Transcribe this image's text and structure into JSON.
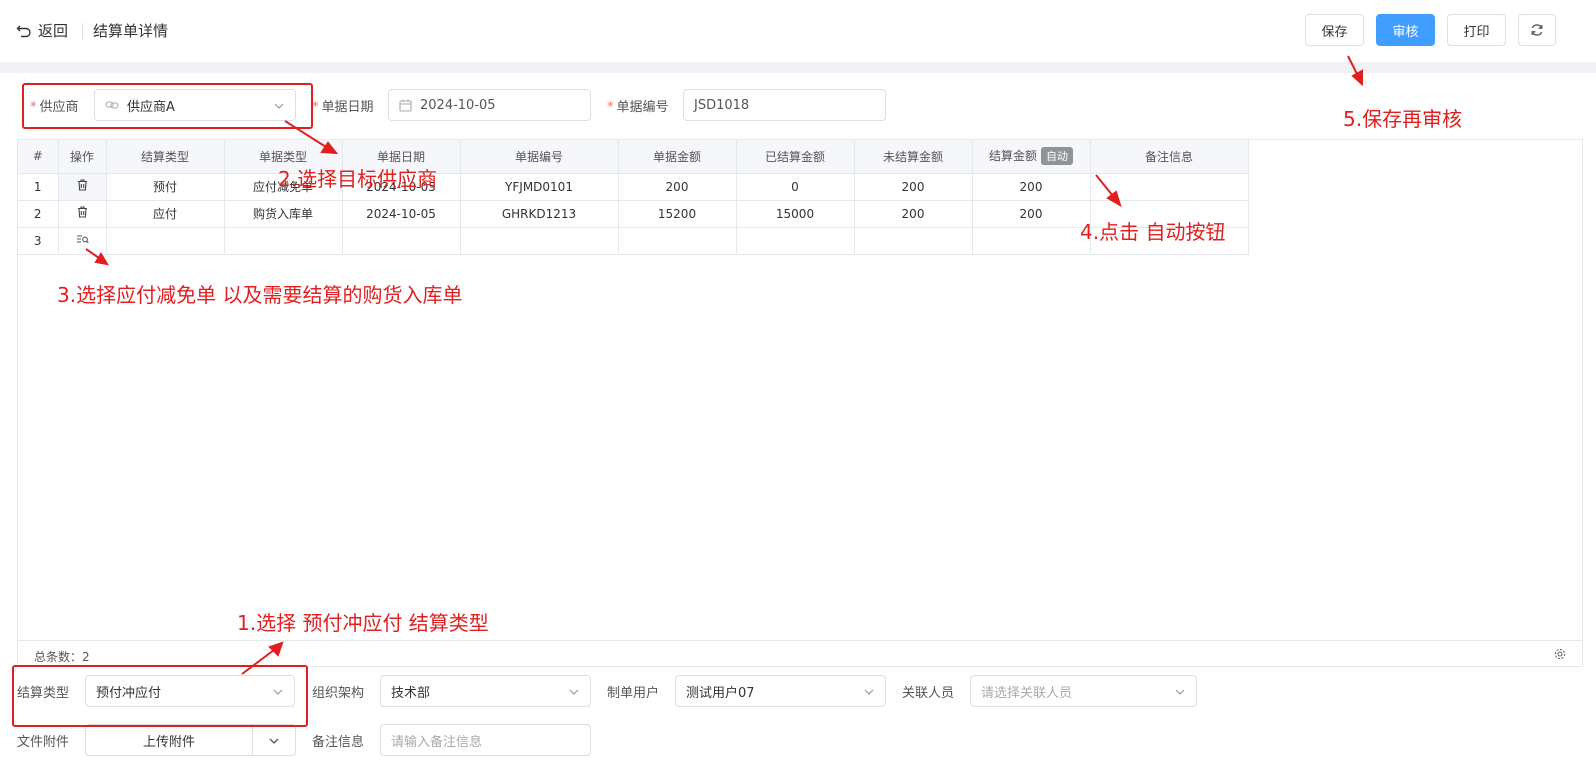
{
  "header": {
    "back_label": "返回",
    "title": "结算单详情",
    "save_label": "保存",
    "approve_label": "审核",
    "print_label": "打印"
  },
  "form_top": {
    "supplier_label": "供应商",
    "supplier_value": "供应商A",
    "date_label": "单据日期",
    "date_value": "2024-10-05",
    "code_label": "单据编号",
    "code_value": "JSD1018"
  },
  "table": {
    "headers": [
      "#",
      "操作",
      "结算类型",
      "单据类型",
      "单据日期",
      "单据编号",
      "单据金额",
      "已结算金额",
      "未结算金额",
      "结算金额",
      "备注信息"
    ],
    "auto_label": "自动",
    "rows": [
      {
        "no": "1",
        "settle_type": "预付",
        "doc_type": "应付减免单",
        "date": "2024-10-05",
        "code": "YFJMD0101",
        "amount": "200",
        "settled": "0",
        "unsettled": "200",
        "settle_amount": "200",
        "remark": ""
      },
      {
        "no": "2",
        "settle_type": "应付",
        "doc_type": "购货入库单",
        "date": "2024-10-05",
        "code": "GHRKD1213",
        "amount": "15200",
        "settled": "15000",
        "unsettled": "200",
        "settle_amount": "200",
        "remark": ""
      },
      {
        "no": "3",
        "settle_type": "",
        "doc_type": "",
        "date": "",
        "code": "",
        "amount": "",
        "settled": "",
        "unsettled": "",
        "settle_amount": "",
        "remark": ""
      }
    ],
    "total_label": "总条数：",
    "total_count": "2"
  },
  "form_bottom": {
    "settle_type_label": "结算类型",
    "settle_type_value": "预付冲应付",
    "org_label": "组织架构",
    "org_value": "技术部",
    "creator_label": "制单用户",
    "creator_value": "测试用户07",
    "related_label": "关联人员",
    "related_placeholder": "请选择关联人员",
    "attach_label": "文件附件",
    "attach_button": "上传附件",
    "remark_label": "备注信息",
    "remark_placeholder": "请输入备注信息"
  },
  "annotations": {
    "step1": "1.选择 预付冲应付 结算类型",
    "step2": "2.选择目标供应商",
    "step3": "3.选择应付减免单 以及需要结算的购货入库单",
    "step4": "4.点击 自动按钮",
    "step5": "5.保存再审核"
  },
  "colors": {
    "primary": "#409eff",
    "annotation": "#e02020",
    "required": "#f56c6c"
  }
}
